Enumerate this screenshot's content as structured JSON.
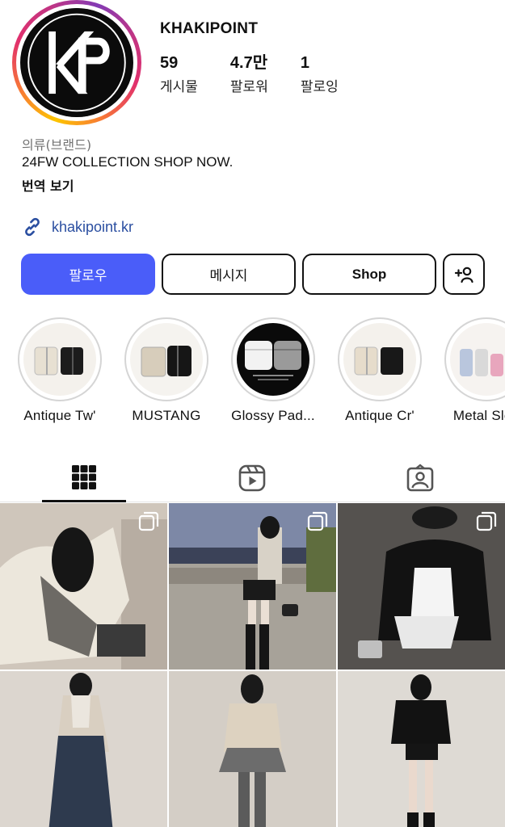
{
  "profile": {
    "username": "KHAKIPOINT",
    "stats": [
      {
        "value": "59",
        "label": "게시물"
      },
      {
        "value": "4.7만",
        "label": "팔로워"
      },
      {
        "value": "1",
        "label": "팔로잉"
      }
    ],
    "category": "의류(브랜드)",
    "bio": "24FW COLLECTION SHOP NOW.",
    "translate": "번역 보기",
    "link": "khakipoint.kr"
  },
  "buttons": {
    "follow": "팔로우",
    "message": "메시지",
    "shop": "Shop"
  },
  "highlights": [
    {
      "label": "Antique Tw'"
    },
    {
      "label": "MUSTANG"
    },
    {
      "label": "Glossy Pad..."
    },
    {
      "label": "Antique Cr'"
    },
    {
      "label": "Metal Slee"
    }
  ],
  "tabs": [
    "posts-grid",
    "reels",
    "tagged"
  ],
  "colors": {
    "follow_button": "#4a5df9",
    "link": "#2a4ea0",
    "muted_text": "#737373"
  }
}
